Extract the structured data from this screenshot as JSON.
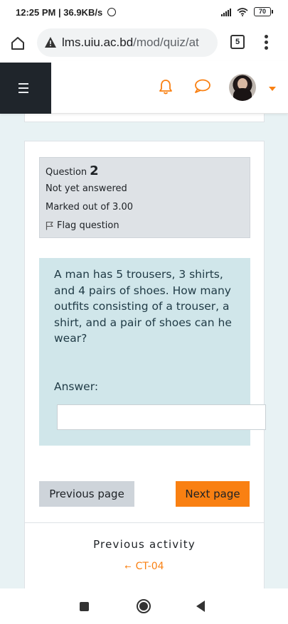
{
  "status_bar": {
    "time": "12:25 PM",
    "network_speed": "36.9KB/s",
    "battery": "70"
  },
  "browser": {
    "url_host": "lms.uiu.ac.bd",
    "url_path": "/mod/quiz/at",
    "tab_count": "5"
  },
  "question_info": {
    "label": "Question",
    "number": "2",
    "state": "Not yet answered",
    "marks": "Marked out of 3.00",
    "flag_label": "Flag question"
  },
  "question": {
    "text": "A man has 5 trousers, 3 shirts, and 4 pairs of shoes. How many outfits consisting of a trouser, a shirt, and a pair of shoes can he wear?",
    "answer_label": "Answer:",
    "answer_value": ""
  },
  "navigation": {
    "previous_page": "Previous page",
    "next_page": "Next page"
  },
  "activity": {
    "heading": "Previous activity",
    "link": "CT-04"
  },
  "colors": {
    "accent": "#f98012",
    "navbar_drawer": "#1f252b",
    "page_bg": "#e8f2f4",
    "question_bg": "#d0e6ea",
    "info_bg": "#dee2e6"
  },
  "icons": {
    "home": "home-icon",
    "warning": "warning-icon",
    "bell": "bell-icon",
    "chat": "chat-icon",
    "flag": "flag-icon",
    "hamburger": "hamburger-icon"
  }
}
